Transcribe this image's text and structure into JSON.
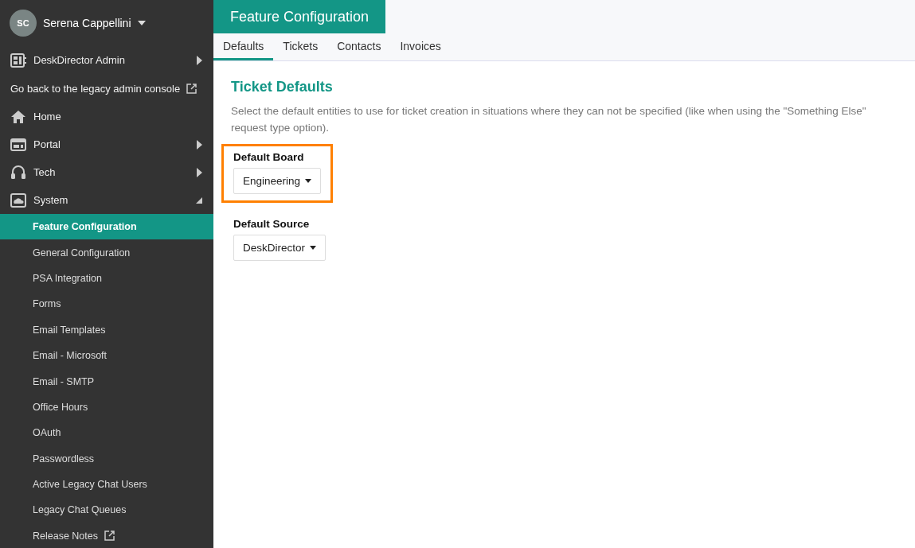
{
  "sidebar": {
    "user": {
      "initials": "SC",
      "name": "Serena Cappellini"
    },
    "items": [
      {
        "kind": "section",
        "label": "DeskDirector Admin",
        "expanded": false
      },
      {
        "kind": "external",
        "label": "Go back to the legacy admin console"
      },
      {
        "kind": "link",
        "label": "Home"
      },
      {
        "kind": "section",
        "label": "Portal",
        "expanded": false
      },
      {
        "kind": "section",
        "label": "Tech",
        "expanded": false
      },
      {
        "kind": "section",
        "label": "System",
        "expanded": true,
        "children": [
          {
            "kind": "page",
            "label": "Feature Configuration",
            "selected": true
          },
          {
            "kind": "page",
            "label": "General Configuration",
            "selected": false
          },
          {
            "kind": "page",
            "label": "PSA Integration",
            "selected": false
          },
          {
            "kind": "page",
            "label": "Forms",
            "selected": false
          },
          {
            "kind": "page",
            "label": "Email Templates",
            "selected": false
          },
          {
            "kind": "page",
            "label": "Email - Microsoft",
            "selected": false
          },
          {
            "kind": "page",
            "label": "Email - SMTP",
            "selected": false
          },
          {
            "kind": "page",
            "label": "Office Hours",
            "selected": false
          },
          {
            "kind": "page",
            "label": "OAuth",
            "selected": false
          },
          {
            "kind": "page",
            "label": "Passwordless",
            "selected": false
          },
          {
            "kind": "page",
            "label": "Active Legacy Chat Users",
            "selected": false
          },
          {
            "kind": "page",
            "label": "Legacy Chat Queues",
            "selected": false
          },
          {
            "kind": "external",
            "label": "Release Notes",
            "selected": false
          }
        ]
      }
    ]
  },
  "page_title": "Feature Configuration",
  "tabs": [
    {
      "label": "Defaults",
      "selected": true
    },
    {
      "label": "Tickets",
      "selected": false
    },
    {
      "label": "Contacts",
      "selected": false
    },
    {
      "label": "Invoices",
      "selected": false
    }
  ],
  "section": {
    "title": "Ticket Defaults",
    "description": "Select the default entities to use for ticket creation in situations where they can not be specified (like when using the \"Something Else\" request type option).",
    "fields": [
      {
        "label": "Default Board",
        "value": "Engineering",
        "highlighted": true
      },
      {
        "label": "Default Source",
        "value": "DeskDirector",
        "highlighted": false
      }
    ]
  }
}
